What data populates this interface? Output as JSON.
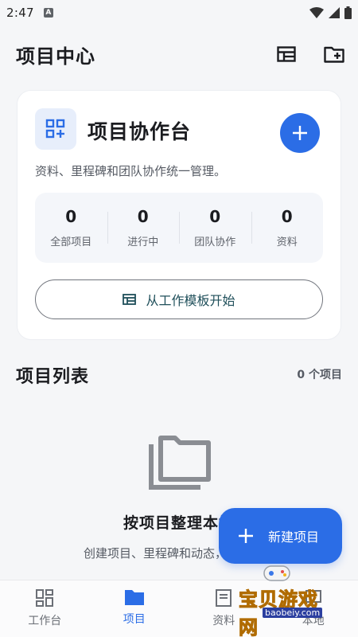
{
  "status_bar": {
    "time": "2:47",
    "badge": "A"
  },
  "header": {
    "title": "项目中心"
  },
  "hero": {
    "title": "项目协作台",
    "description": "资料、里程碑和团队协作统一管理。",
    "stats": [
      {
        "value": "0",
        "label": "全部项目"
      },
      {
        "value": "0",
        "label": "进行中"
      },
      {
        "value": "0",
        "label": "团队协作"
      },
      {
        "value": "0",
        "label": "资料"
      }
    ],
    "template_button": "从工作模板开始"
  },
  "list": {
    "title": "项目列表",
    "count": "0 个项目"
  },
  "empty": {
    "title": "按项目整理本地",
    "description": "创建项目、里程碑和动态，档文件。"
  },
  "fab": {
    "label": "新建项目"
  },
  "bottom_nav": [
    {
      "label": "工作台",
      "icon": "dashboard-icon"
    },
    {
      "label": "项目",
      "icon": "folder-icon",
      "active": true
    },
    {
      "label": "资料",
      "icon": "document-icon"
    },
    {
      "label": "本地",
      "icon": "device-icon"
    }
  ],
  "watermark": {
    "text": "宝贝游戏网",
    "sub": "baobeiy.com"
  },
  "colors": {
    "accent": "#2b6de6",
    "background": "#f5f6f8",
    "card": "#ffffff"
  }
}
